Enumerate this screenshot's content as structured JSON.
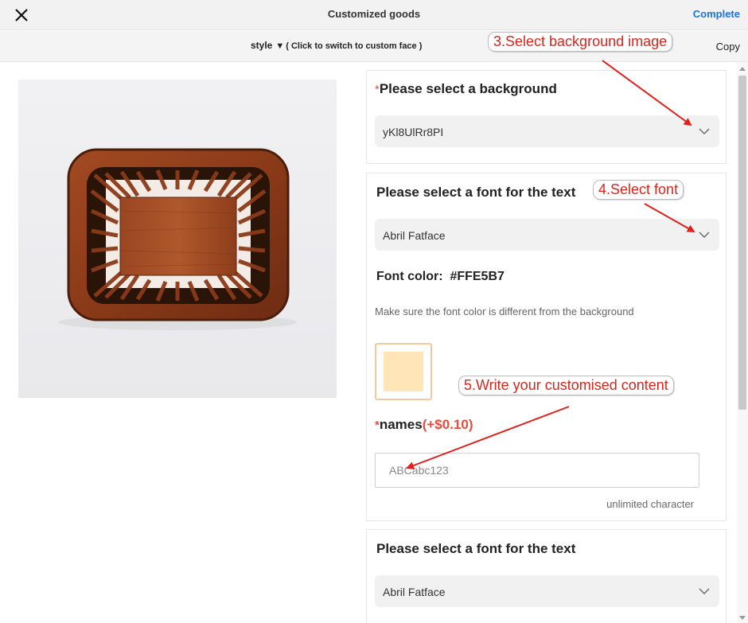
{
  "header": {
    "title": "Customized goods",
    "complete_label": "Complete"
  },
  "stylebar": {
    "style_label": "style",
    "triangle": "▼",
    "hint": "( Click to switch to custom face )",
    "copy_label": "Copy"
  },
  "background_section": {
    "required_mark": "*",
    "label": "Please select a background",
    "selected": "yKl8UlRr8PI"
  },
  "font_section": {
    "label": "Please select a font for the text",
    "selected_font": "Abril Fatface",
    "font_color_label": "Font color:",
    "font_color_value": "#FFE5B7",
    "note": "Make sure the font color is different from the background",
    "swatch_color": "#FFE5B7"
  },
  "names_field": {
    "required_mark": "*",
    "label": "names",
    "price": "(+$0.10)",
    "placeholder": "ABCabc123",
    "limit_note": "unlimited character"
  },
  "font_section_2": {
    "label": "Please select a font for the text",
    "selected_font": "Abril Fatface"
  },
  "annotations": [
    {
      "text": "3.Select background image"
    },
    {
      "text": "4.Select font"
    },
    {
      "text": "5.Write your customised content"
    }
  ],
  "colors": {
    "accent": "#1a73e8",
    "required": "#e74c3c",
    "annotation": "#d8261c"
  },
  "icons": {
    "close": "close-icon",
    "chevron": "chevron-down-icon"
  }
}
